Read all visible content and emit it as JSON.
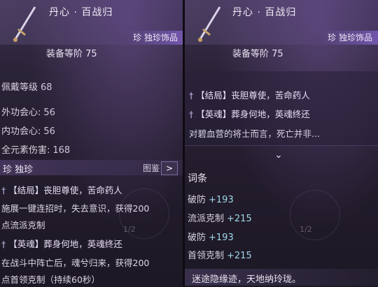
{
  "left": {
    "title": "丹心 · 百战归",
    "rank_label": "珍 独珍饰品",
    "gear_level": "装备等阶 75",
    "stats": [
      {
        "label": "佩戴等级",
        "value": "68"
      },
      {
        "label": "外功会心:",
        "value": "56"
      },
      {
        "label": "内功会心:",
        "value": "56"
      },
      {
        "label": "全元素伤害:",
        "value": "168"
      }
    ],
    "section_title": "珍 独珍",
    "tujian": "图鉴",
    "arrow": ">",
    "lines": [
      {
        "dagger": "†",
        "text": "【结局】丧胆尊使，苦命药人"
      },
      {
        "dagger": "",
        "text": "施展一键连招时，失去意识，获得200"
      },
      {
        "dagger": "",
        "text": "点流派克制"
      },
      {
        "dagger": "†",
        "text": "【英魂】葬身何地，英魂终还"
      },
      {
        "dagger": "",
        "text": "在战斗中阵亡后，魂兮归来，获得200"
      },
      {
        "dagger": "",
        "text": "点首领克制（持续60秒）"
      }
    ],
    "pager": "1/2"
  },
  "right": {
    "title": "丹心 · 百战归",
    "rank_label": "珍 独珍饰品",
    "gear_level": "装备等阶 75",
    "lines": [
      {
        "dagger": "†",
        "text": "【结局】丧胆尊使，苦命药人"
      },
      {
        "dagger": "†",
        "text": "【英魂】葬身何地，英魂终还"
      },
      {
        "dagger": "",
        "text": "对碧血营的将士而言，死亡并非..."
      }
    ],
    "chevron": "⌄",
    "subhead": "词条",
    "attrs": [
      {
        "label": "破防",
        "value": "+193"
      },
      {
        "label": "流派克制",
        "value": "+215"
      },
      {
        "label": "破防",
        "value": "+193"
      },
      {
        "label": "首领克制",
        "value": "+215"
      }
    ],
    "bottom_note": "迷途隐缘迹，天地纳玲珑。",
    "pager": "1/2"
  },
  "colors": {
    "accent": "#8a6cc4",
    "value": "#9fd6e8"
  }
}
